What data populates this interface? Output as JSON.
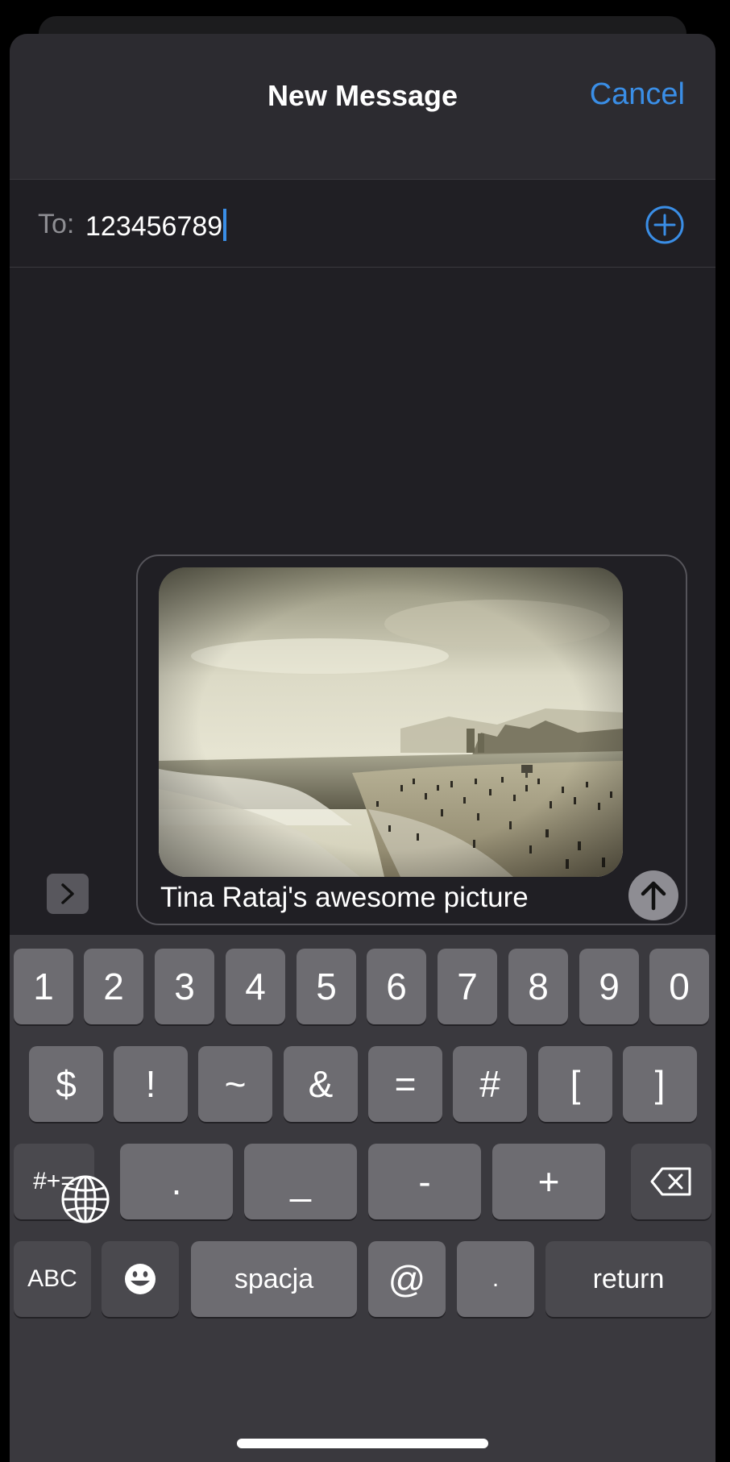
{
  "header": {
    "title": "New Message",
    "cancel_label": "Cancel"
  },
  "recipient": {
    "label": "To:",
    "value": "123456789"
  },
  "message": {
    "text": "Tina Rataj's awesome picture",
    "attachment": "beach-photo"
  },
  "icons": {
    "add_recipient": "plus-circle-icon",
    "expand_apps": "chevron-right-icon",
    "send": "arrow-up-icon",
    "delete": "backspace-icon",
    "emoji": "smiley-icon",
    "globe": "globe-icon"
  },
  "colors": {
    "accent": "#3a8ee6",
    "background": "#201f24",
    "key": "#6d6c71",
    "key_dark": "#4a494e"
  },
  "keyboard": {
    "row1": [
      "1",
      "2",
      "3",
      "4",
      "5",
      "6",
      "7",
      "8",
      "9",
      "0"
    ],
    "row2": [
      "$",
      "!",
      "~",
      "&",
      "=",
      "#",
      "[",
      "]"
    ],
    "row3": {
      "mode": "#+=",
      "keys": [
        ".",
        "_",
        "-",
        "+"
      ]
    },
    "row4": {
      "abc": "ABC",
      "space": "spacja",
      "at": "@",
      "dot": ".",
      "return": "return"
    }
  }
}
